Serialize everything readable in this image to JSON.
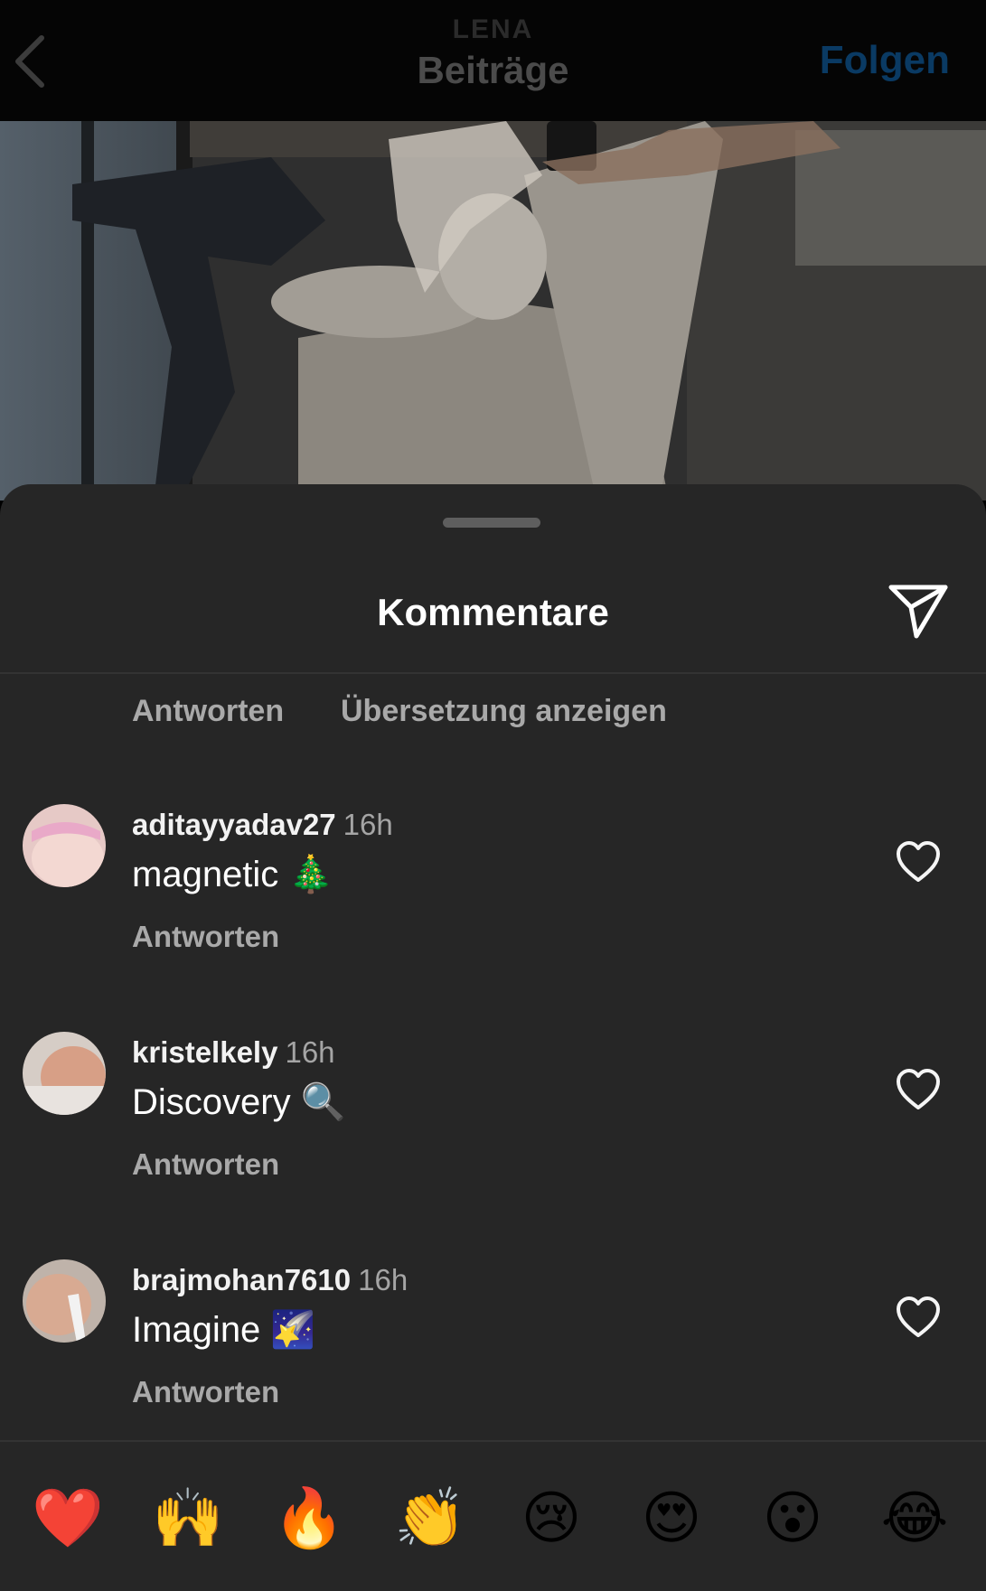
{
  "nav": {
    "username": "LENA",
    "subtitle": "Beiträge",
    "follow_label": "Folgen"
  },
  "sheet": {
    "title": "Kommentare",
    "prev_actions": {
      "reply_label": "Antworten",
      "translate_label": "Übersetzung anzeigen"
    }
  },
  "comments": [
    {
      "username": "aditayyadav27",
      "time": "16h",
      "text": "magnetic 🎄",
      "reply_label": "Antworten"
    },
    {
      "username": "kristelkely",
      "time": "16h",
      "text": "Discovery 🔍",
      "reply_label": "Antworten"
    },
    {
      "username": "brajmohan7610",
      "time": "16h",
      "text": "Imagine 🌠",
      "reply_label": "Antworten"
    }
  ],
  "reactions": [
    "❤️",
    "🙌",
    "🔥",
    "👏",
    "😢",
    "😍",
    "😮",
    "😂"
  ],
  "colors": {
    "sheet_bg": "#262626",
    "follow_blue": "#0a3a63",
    "muted_text": "#a9a9a9"
  }
}
